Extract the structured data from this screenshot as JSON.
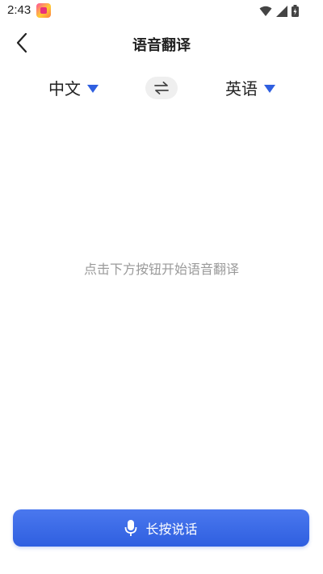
{
  "status_bar": {
    "time": "2:43",
    "icons": [
      "app-notification-icon",
      "wifi-icon",
      "signal-icon",
      "battery-icon"
    ]
  },
  "nav": {
    "title": "语音翻译",
    "back_icon": "chevron-left-icon"
  },
  "languages": {
    "source": "中文",
    "target": "英语",
    "swap_icon": "swap-arrows-icon",
    "caret_color": "#2f5fe0"
  },
  "main": {
    "hint": "点击下方按钮开始语音翻译"
  },
  "talk_button": {
    "label": "长按说话",
    "icon": "microphone-icon",
    "color": "#3a68e6"
  }
}
